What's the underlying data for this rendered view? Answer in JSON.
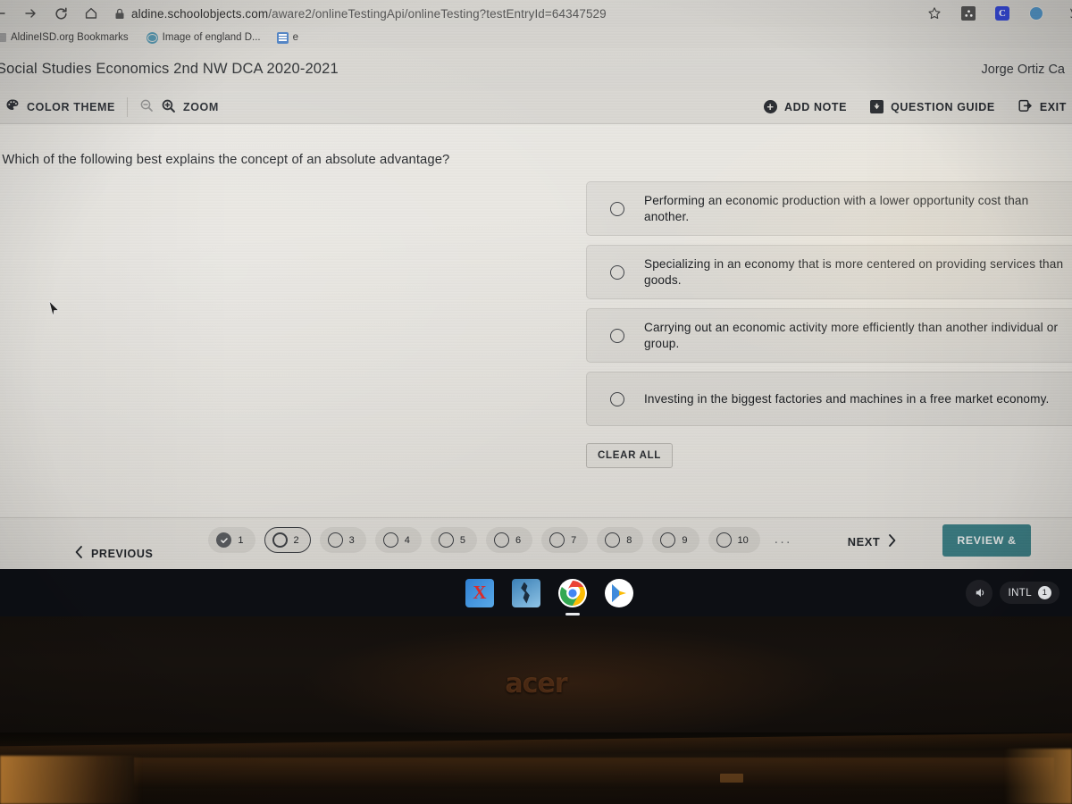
{
  "browser": {
    "nav_icons": [
      "back-arrow",
      "forward-arrow",
      "reload",
      "home"
    ],
    "lock_icon": "lock-icon",
    "url_host": "aldine.schoolobjects.com",
    "url_path": "/aware2/onlineTestingApi/onlineTesting?testEntryId=64347529",
    "toolbar_right_icons": [
      "star-icon",
      "extension-icon",
      "clever-icon",
      "profile-icon",
      "pin-icon"
    ],
    "bookmarks": [
      {
        "label": "AldineISD.org Bookmarks",
        "icon": "folder-icon"
      },
      {
        "label": "Image of england D...",
        "icon": "globe-icon"
      },
      {
        "label": "e",
        "icon": "document-icon"
      }
    ]
  },
  "test": {
    "title": "Social Studies Economics 2nd NW DCA 2020-2021",
    "user": "Jorge Ortiz Ca",
    "toolbar": {
      "color_theme": "COLOR THEME",
      "zoom": "ZOOM",
      "add_note": "ADD NOTE",
      "question_guide": "QUESTION GUIDE",
      "exit": "EXIT"
    },
    "question": {
      "number_prefix": ".",
      "stem": ". Which of the following best explains the concept of an absolute advantage?",
      "options": [
        {
          "id": "A",
          "text": "Performing an economic production with a lower opportunity cost than another.",
          "selected": false
        },
        {
          "id": "B",
          "text": "Specializing in an economy that is more centered on providing services than goods.",
          "selected": false
        },
        {
          "id": "C",
          "text": "Carrying out an economic activity more efficiently than another individual or group.",
          "selected": false
        },
        {
          "id": "D",
          "text": "Investing in the biggest factories and machines in a free market economy.",
          "selected": false
        }
      ],
      "clear_all": "CLEAR ALL"
    },
    "nav": {
      "previous": "PREVIOUS",
      "next": "NEXT",
      "review": "REVIEW &",
      "ellipsis": "...",
      "pills": [
        {
          "num": "1",
          "state": "answered"
        },
        {
          "num": "2",
          "state": "current"
        },
        {
          "num": "3",
          "state": "unanswered"
        },
        {
          "num": "4",
          "state": "unanswered"
        },
        {
          "num": "5",
          "state": "unanswered"
        },
        {
          "num": "6",
          "state": "unanswered"
        },
        {
          "num": "7",
          "state": "unanswered"
        },
        {
          "num": "8",
          "state": "unanswered"
        },
        {
          "num": "9",
          "state": "unanswered"
        },
        {
          "num": "10",
          "state": "unanswered"
        }
      ]
    },
    "accent_color": "#3c8289"
  },
  "shelf": {
    "apps": [
      "xtramath-icon",
      "jumprope-icon",
      "chrome-icon",
      "play-store-icon"
    ],
    "tray": {
      "volume_icon": "volume-icon",
      "ime_label": "INTL",
      "notification_count": "1"
    }
  },
  "device": {
    "brand": "acer"
  }
}
